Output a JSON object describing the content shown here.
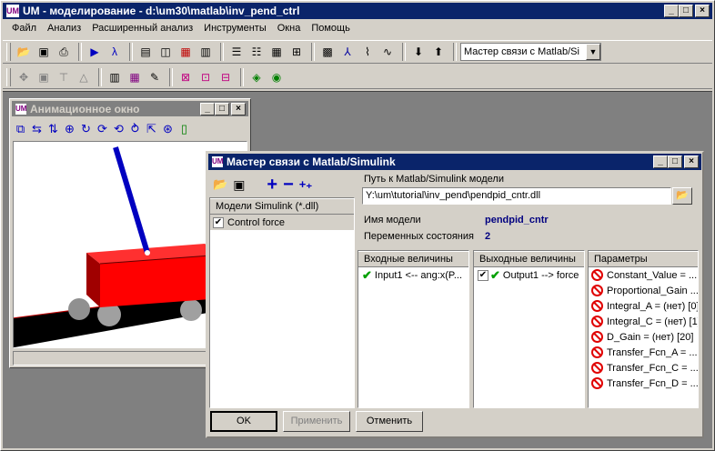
{
  "app": {
    "title": "UM - моделирование - d:\\um30\\matlab\\inv_pend_ctrl"
  },
  "menu": [
    "Файл",
    "Анализ",
    "Расширенный анализ",
    "Инструменты",
    "Окна",
    "Помощь"
  ],
  "toolbar": {
    "combo_value": "Мастер связи с Matlab/Si"
  },
  "anim_window": {
    "title": "Анимационное окно"
  },
  "dialog": {
    "title": "Мастер связи с Matlab/Simulink",
    "models_header": "Модели Simulink (*.dll)",
    "models": [
      {
        "label": "Control force",
        "checked": true
      }
    ],
    "path_label": "Путь к Matlab/Simulink модели",
    "path_value": "Y:\\um\\tutorial\\inv_pend\\pendpid_cntr.dll",
    "model_name_label": "Имя модели",
    "model_name_value": "pendpid_cntr",
    "state_vars_label": "Переменных состояния",
    "state_vars_value": "2",
    "inputs": {
      "header": "Входные величины",
      "items": [
        "Input1 <-- ang:x(P..."
      ]
    },
    "outputs": {
      "header": "Выходные величины",
      "items": [
        "Output1 --> force"
      ]
    },
    "params": {
      "header": "Параметры",
      "items": [
        "Constant_Value = ...",
        "Proportional_Gain ...",
        "Integral_A = (нет) [0]",
        "Integral_C = (нет) [1]",
        "D_Gain = (нет) [20]",
        "Transfer_Fcn_A = ...",
        "Transfer_Fcn_C = ...",
        "Transfer_Fcn_D = ..."
      ]
    },
    "buttons": {
      "ok": "OK",
      "apply": "Применить",
      "cancel": "Отменить"
    }
  },
  "colors": {
    "accent": "#0a246a",
    "value_text": "#000080",
    "cart": "#ff0000",
    "pole": "#0000c0"
  }
}
